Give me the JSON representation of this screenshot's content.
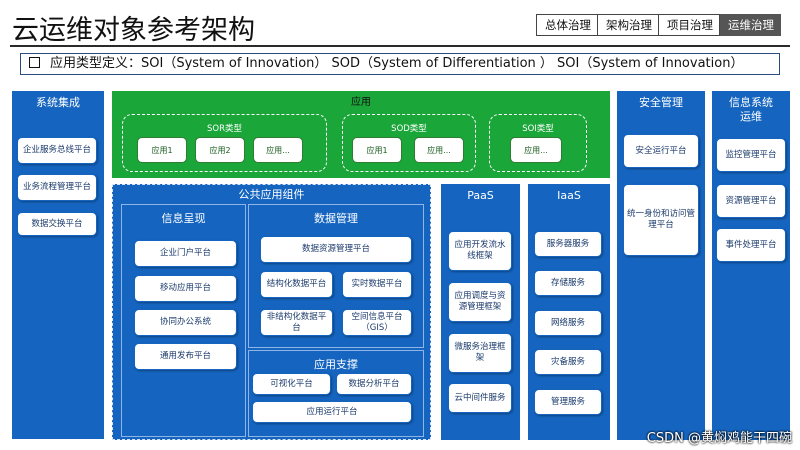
{
  "page_title": "云运维对象参考架构",
  "breadcrumbs": [
    "总体治理",
    "架构治理",
    "项目治理",
    "运维治理"
  ],
  "definition": "应用类型定义：SOI（System of Innovation） SOD（System of Differentiation ） SOI（System of Innovation）",
  "system_integration": {
    "title": "系统集成",
    "items": [
      "企业服务总线平台",
      "业务流程管理平台",
      "数据交换平台"
    ]
  },
  "application": {
    "title": "应用",
    "groups": [
      {
        "title": "SOR类型",
        "items": [
          "应用1",
          "应用2",
          "应用..."
        ]
      },
      {
        "title": "SOD类型",
        "items": [
          "应用1",
          "应用..."
        ]
      },
      {
        "title": "SOI类型",
        "items": [
          "应用..."
        ]
      }
    ]
  },
  "public_components": {
    "title": "公共应用组件",
    "info_display": {
      "title": "信息呈现",
      "items": [
        "企业门户平台",
        "移动应用平台",
        "协同办公系统",
        "通用发布平台"
      ]
    },
    "data_management": {
      "title": "数据管理",
      "items": [
        "数据资源管理平台",
        "结构化数据平台",
        "实时数据平台",
        "非结构化数据平台",
        "空间信息平台（GIS）"
      ]
    },
    "app_support": {
      "title": "应用支撑",
      "items": [
        "可视化平台",
        "数据分析平台",
        "应用运行平台"
      ]
    }
  },
  "paas": {
    "title": "PaaS",
    "items": [
      "应用开发流水线框架",
      "应用调度与资源管理框架",
      "微服务治理框架",
      "云中间件服务"
    ]
  },
  "iaas": {
    "title": "IaaS",
    "items": [
      "服务器服务",
      "存储服务",
      "网络服务",
      "灾备服务",
      "管理服务"
    ]
  },
  "security": {
    "title": "安全管理",
    "items": [
      "安全运行平台",
      "统一身份和访问管理平台"
    ]
  },
  "it_ops": {
    "title": "信息系统运维",
    "items": [
      "监控管理平台",
      "资源管理平台",
      "事件处理平台"
    ]
  },
  "watermark": "CSDN @黄焖鸡能干四碗"
}
